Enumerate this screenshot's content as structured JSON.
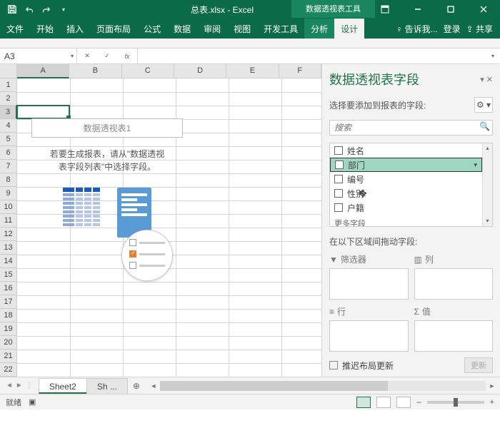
{
  "titlebar": {
    "title": "总表.xlsx - Excel",
    "toolbox": "数据透视表工具"
  },
  "ribbon": {
    "tabs": [
      "文件",
      "开始",
      "插入",
      "页面布局",
      "公式",
      "数据",
      "审阅",
      "视图",
      "开发工具",
      "分析",
      "设计"
    ],
    "tell_me": "告诉我...",
    "login": "登录",
    "share": "共享"
  },
  "namebox": {
    "value": "A3"
  },
  "formula": {
    "fx": "fx"
  },
  "cols": [
    "A",
    "B",
    "C",
    "D",
    "E",
    "F"
  ],
  "rows": [
    "1",
    "2",
    "3",
    "4",
    "5",
    "6",
    "7",
    "8",
    "9",
    "10",
    "11",
    "12",
    "13",
    "14",
    "15",
    "16",
    "17",
    "18",
    "19",
    "20",
    "21",
    "22"
  ],
  "pivot_ph": {
    "title": "数据透视表1",
    "hint1": "若要生成报表，请从\"数据透视",
    "hint2": "表字段列表\"中选择字段。"
  },
  "pane": {
    "title": "数据透视表字段",
    "subtitle": "选择要添加到报表的字段:",
    "search_ph": "搜索",
    "fields": [
      "姓名",
      "部门",
      "编号",
      "性别",
      "户籍"
    ],
    "more": "更多字段",
    "drag_label": "在以下区域间拖动字段:",
    "zones": {
      "filter": "筛选器",
      "cols": "列",
      "rows": "行",
      "vals": "值"
    },
    "defer": "推迟布局更新",
    "update": "更新"
  },
  "sheets": {
    "nav_prev": "◄",
    "nav_next": "►",
    "vdots": "⋮",
    "tabs": [
      "Sheet2",
      "Sh ..."
    ],
    "add": "⊕"
  },
  "status": {
    "ready": "就绪",
    "zoom_minus": "–",
    "zoom_plus": "+"
  }
}
